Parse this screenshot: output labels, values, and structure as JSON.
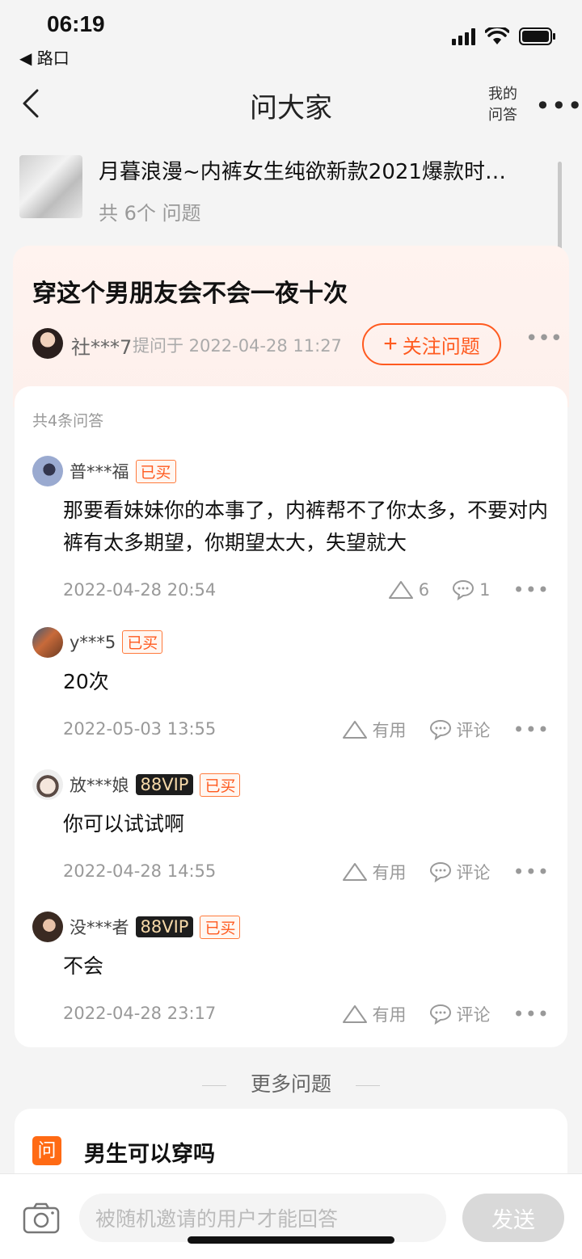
{
  "status_bar": {
    "time": "06:19",
    "back_app": "◀ 路口"
  },
  "nav": {
    "title": "问大家",
    "my_qa": "我的问答",
    "more": "•••"
  },
  "product": {
    "title": "月暮浪漫~内裤女生纯欲新款2021爆款时…",
    "count": "共 6个 问题"
  },
  "question": {
    "title": "穿这个男朋友会不会一夜十次",
    "user": "社***7",
    "asked_at": "提问于 2022-04-28 11:27",
    "follow_label": "关注问题",
    "follow_plus": "+",
    "more": "•••"
  },
  "answers_count": "共4条问答",
  "answers": [
    {
      "user": "普***福",
      "vip": "",
      "bought": "已买",
      "text": "那要看妹妹你的本事了，内裤帮不了你太多，不要对内裤有太多期望，你期望太大，失望就大",
      "date": "2022-04-28 20:54",
      "useful": "6",
      "comment": "1"
    },
    {
      "user": "y***5",
      "vip": "",
      "bought": "已买",
      "text": "20次",
      "date": "2022-05-03 13:55",
      "useful": "有用",
      "comment": "评论"
    },
    {
      "user": "放***娘",
      "vip": "88VIP",
      "bought": "已买",
      "text": "你可以试试啊",
      "date": "2022-04-28 14:55",
      "useful": "有用",
      "comment": "评论"
    },
    {
      "user": "没***者",
      "vip": "88VIP",
      "bought": "已买",
      "text": "不会",
      "date": "2022-04-28 23:17",
      "useful": "有用",
      "comment": "评论"
    }
  ],
  "more_questions": {
    "heading": "更多问题",
    "icon": "问",
    "first": "男生可以穿吗"
  },
  "bottom": {
    "placeholder": "被随机邀请的用户才能回答",
    "send": "发送"
  },
  "colors": {
    "accent": "#ff5a1f",
    "vip_bg": "#1d1d1d",
    "vip_text": "#f5d8a8"
  }
}
